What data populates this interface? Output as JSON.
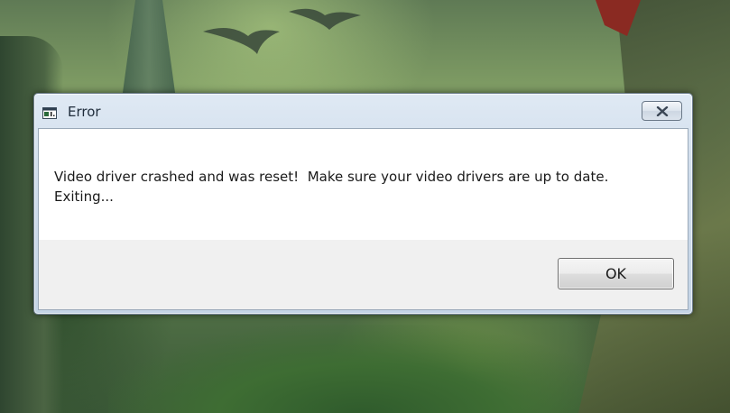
{
  "dialog": {
    "title": "Error",
    "icon": "application-window-icon",
    "close_icon": "close-icon",
    "message_lines": [
      "Video driver crashed and was reset!  Make sure your video drivers are up to date.",
      "Exiting..."
    ],
    "ok_label": "OK"
  },
  "colors": {
    "titlebar": "#cfdceb",
    "content_background": "#f0f0f0",
    "message_background": "#ffffff"
  }
}
